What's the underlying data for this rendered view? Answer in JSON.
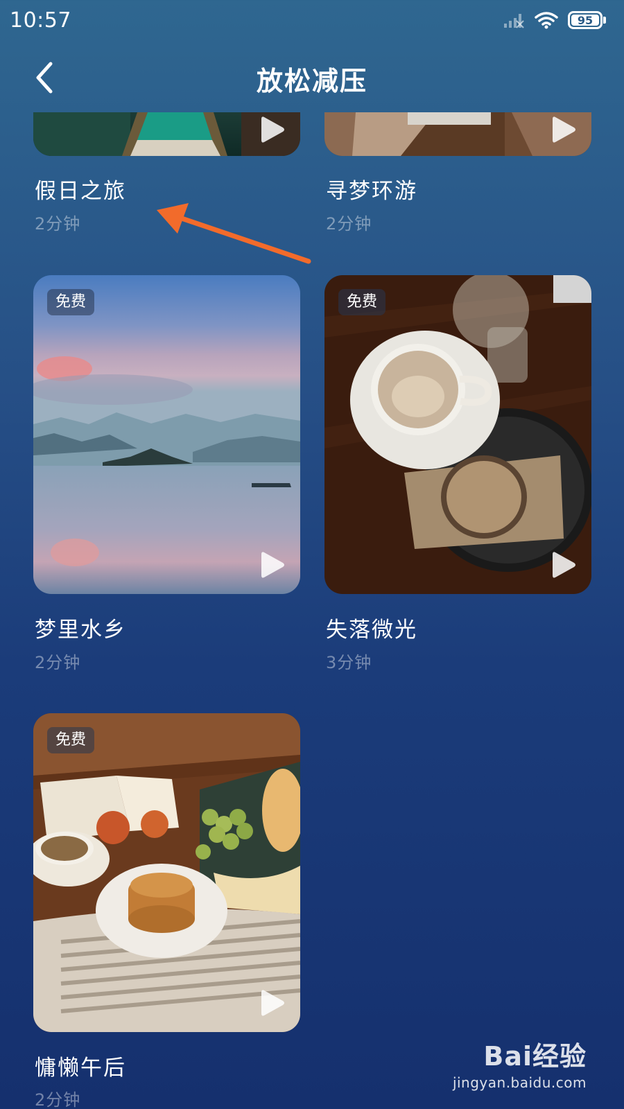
{
  "status_bar": {
    "time": "10:57",
    "battery": "95"
  },
  "nav": {
    "title": "放松减压"
  },
  "items": [
    {
      "title": "假日之旅",
      "duration": "2分钟",
      "free_label": ""
    },
    {
      "title": "寻梦环游",
      "duration": "2分钟",
      "free_label": ""
    },
    {
      "title": "梦里水乡",
      "duration": "2分钟",
      "free_label": "免费"
    },
    {
      "title": "失落微光",
      "duration": "3分钟",
      "free_label": "免费"
    },
    {
      "title": "慵懒午后",
      "duration": "2分钟",
      "free_label": "免费"
    }
  ],
  "watermark": {
    "logo": "Bai经验",
    "url": "jingyan.baidu.com"
  },
  "colors": {
    "background_top": "#2f6790",
    "background_bottom": "#15306e",
    "annotation_arrow": "#f26b2b"
  }
}
